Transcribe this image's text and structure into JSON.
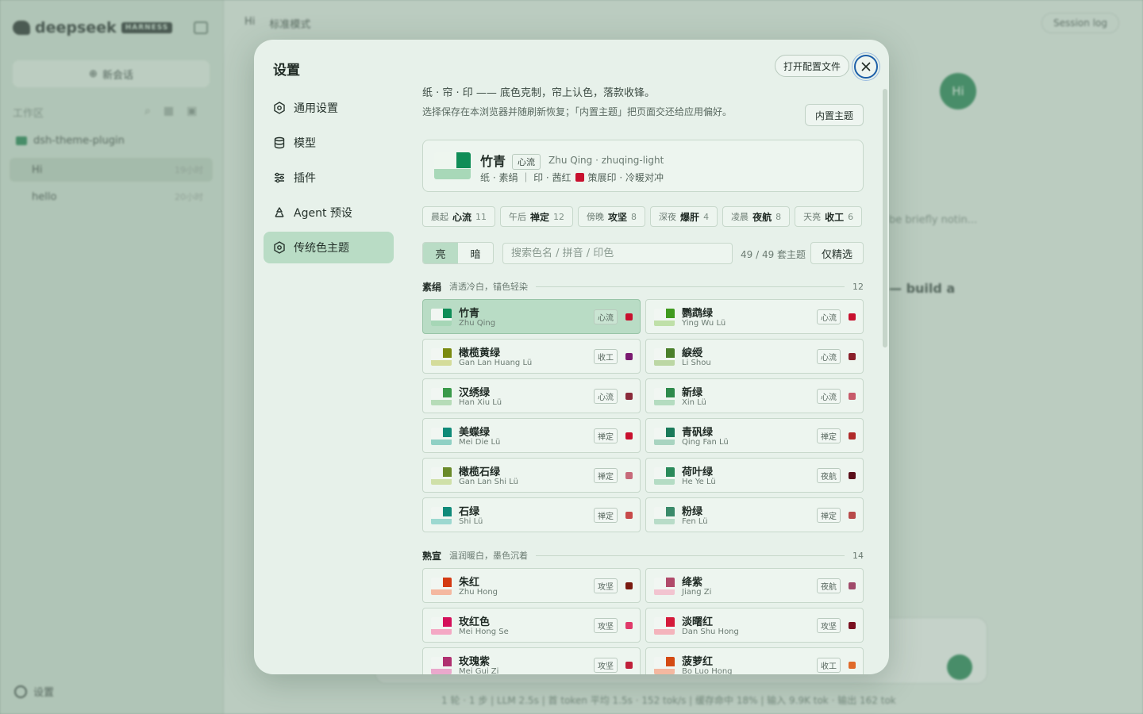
{
  "background_app": {
    "logo_text": "deepseek",
    "logo_badge": "HARNESS",
    "new_chat": "新会话",
    "workspace_label": "工作区",
    "project": "dsh-theme-plugin",
    "sessions": [
      {
        "name": "Hi",
        "time": "19小时"
      },
      {
        "name": "hello",
        "time": "20小时"
      }
    ],
    "settings_label": "设置",
    "tabs": [
      "Hi",
      "标准模式"
    ],
    "session_log": "Session log",
    "avatar": "Hi",
    "text1": "be briefly notin...",
    "text2": "— build a",
    "status": "1 轮 · 1 步  |  LLM 2.5s  |  首 token 平均 1.5s · 152 tok/s  |  缓存命中 18%  |  输入 9.9K tok · 输出 162 tok"
  },
  "modal": {
    "title": "设置",
    "open_config": "打开配置文件",
    "nav": [
      {
        "label": "通用设置",
        "icon": "gear-icon"
      },
      {
        "label": "模型",
        "icon": "database-icon"
      },
      {
        "label": "插件",
        "icon": "sliders-icon"
      },
      {
        "label": "Agent 预设",
        "icon": "recycle-icon"
      },
      {
        "label": "传统色主题",
        "icon": "gear-icon"
      }
    ],
    "desc1": "纸 · 帘 · 印 —— 底色克制，帘上认色，落款收锋。",
    "desc2": "选择保存在本浏览器并随刷新恢复；「内置主题」把页面交还给应用偏好。",
    "builtin_button": "内置主题",
    "current": {
      "name": "竹青",
      "tag": "心流",
      "pinyin": "Zhu Qing · zhuqing-light",
      "meta_left": "纸 · 素绢 ｜ 印 · 茜红",
      "meta_right": "策展印 · 冷暖对冲",
      "accent": "#0f8d57",
      "bar": "#a8d8b8",
      "seal": "#c8102e"
    },
    "moods": [
      {
        "time": "晨起",
        "name": "心流",
        "count": "11"
      },
      {
        "time": "午后",
        "name": "禅定",
        "count": "12"
      },
      {
        "time": "傍晚",
        "name": "攻坚",
        "count": "8"
      },
      {
        "time": "深夜",
        "name": "爆肝",
        "count": "4"
      },
      {
        "time": "凌晨",
        "name": "夜航",
        "count": "8"
      },
      {
        "time": "天亮",
        "name": "收工",
        "count": "6"
      }
    ],
    "mode_light": "亮",
    "mode_dark": "暗",
    "search_placeholder": "搜索色名 / 拼音 / 印色",
    "count_label": "49 / 49 套主题",
    "featured_button": "仅精选",
    "groups": [
      {
        "name": "素绢",
        "desc": "清透冷白，锚色轻染",
        "count": "12",
        "themes": [
          {
            "name": "竹青",
            "pinyin": "Zhu Qing",
            "tag": "心流",
            "accent": "#0f8d57",
            "bar": "#a6d6b6",
            "seal": "#c8102e",
            "selected": true
          },
          {
            "name": "鹦鹉绿",
            "pinyin": "Ying Wu Lü",
            "tag": "心流",
            "accent": "#3f9a1e",
            "bar": "#bfe0a8",
            "seal": "#c8102e"
          },
          {
            "name": "橄榄黄绿",
            "pinyin": "Gan Lan Huang Lü",
            "tag": "收工",
            "accent": "#7a8a10",
            "bar": "#d4dc9a",
            "seal": "#7a1a70"
          },
          {
            "name": "綟绶",
            "pinyin": "Li Shou",
            "tag": "心流",
            "accent": "#4a7f2a",
            "bar": "#bcd7a4",
            "seal": "#8a1f2a"
          },
          {
            "name": "汉绣绿",
            "pinyin": "Han Xiu Lü",
            "tag": "心流",
            "accent": "#3a9a4a",
            "bar": "#b6dcb8",
            "seal": "#8a2a3a"
          },
          {
            "name": "新绿",
            "pinyin": "Xin Lü",
            "tag": "心流",
            "accent": "#2e8a4c",
            "bar": "#b4dcc0",
            "seal": "#c75a6a"
          },
          {
            "name": "美蝶绿",
            "pinyin": "Mei Die Lü",
            "tag": "禅定",
            "accent": "#0f8a78",
            "bar": "#8fd0c4",
            "seal": "#c8102e"
          },
          {
            "name": "青矾绿",
            "pinyin": "Qing Fan Lü",
            "tag": "禅定",
            "accent": "#1a7a5a",
            "bar": "#a8d4c0",
            "seal": "#b02a2a"
          },
          {
            "name": "橄榄石绿",
            "pinyin": "Gan Lan Shi Lü",
            "tag": "禅定",
            "accent": "#6a8a2a",
            "bar": "#cfe0a8",
            "seal": "#c76a7a"
          },
          {
            "name": "荷叶绿",
            "pinyin": "He Ye Lü",
            "tag": "夜航",
            "accent": "#2a8a5a",
            "bar": "#b4dcc4",
            "seal": "#5a0f1a"
          },
          {
            "name": "石绿",
            "pinyin": "Shi Lü",
            "tag": "禅定",
            "accent": "#0f8a7a",
            "bar": "#9cd8d0",
            "seal": "#c84a4a"
          },
          {
            "name": "粉绿",
            "pinyin": "Fen Lü",
            "tag": "禅定",
            "accent": "#3a8a6a",
            "bar": "#b8dcc8",
            "seal": "#b84a4a"
          }
        ]
      },
      {
        "name": "熟宣",
        "desc": "温润暖白，墨色沉着",
        "count": "14",
        "themes": [
          {
            "name": "朱红",
            "pinyin": "Zhu Hong",
            "tag": "攻坚",
            "accent": "#d43a12",
            "bar": "#f4b8a0",
            "seal": "#7a1a10"
          },
          {
            "name": "绛紫",
            "pinyin": "Jiang Zi",
            "tag": "夜航",
            "accent": "#b04a6a",
            "bar": "#f2c4d0",
            "seal": "#a04a6a"
          },
          {
            "name": "玫红色",
            "pinyin": "Mei Hong Se",
            "tag": "攻坚",
            "accent": "#d4105a",
            "bar": "#f4a8c4",
            "seal": "#e03a6a"
          },
          {
            "name": "淡曙红",
            "pinyin": "Dan Shu Hong",
            "tag": "攻坚",
            "accent": "#d41a3a",
            "bar": "#f4b4bc",
            "seal": "#7a1020"
          },
          {
            "name": "玫瑰紫",
            "pinyin": "Mei Gui Zi",
            "tag": "攻坚",
            "accent": "#b03070",
            "bar": "#eaa8cc",
            "seal": "#c0203a"
          },
          {
            "name": "菠萝红",
            "pinyin": "Bo Luo Hong",
            "tag": "收工",
            "accent": "#d44a12",
            "bar": "#f4b8a0",
            "seal": "#e06a2a"
          }
        ]
      }
    ]
  }
}
